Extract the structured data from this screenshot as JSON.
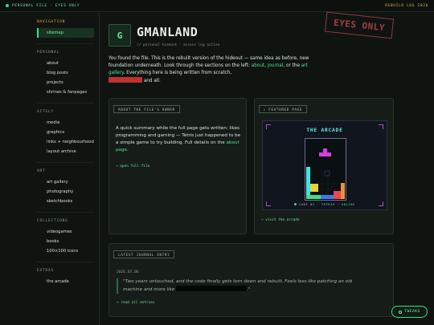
{
  "topbar": {
    "left_label": "PERSONAL FILE · EYES ONLY",
    "right_label": "REBUILD LOG 2026"
  },
  "sidebar": {
    "navigation": {
      "title": "NAVIGATION",
      "items": [
        "sitemap"
      ]
    },
    "personal": {
      "title": "PERSONAL",
      "items": [
        "about",
        "blog posts",
        "projects",
        "shrines & fanpages"
      ]
    },
    "sitely": {
      "title": "SITELY",
      "items": [
        "media",
        "graphics",
        "links + neighbourhood",
        "layout archive"
      ]
    },
    "art": {
      "title": "ART",
      "items": [
        "art gallery",
        "photography",
        "sketchbooks"
      ]
    },
    "collections": {
      "title": "COLLECTIONS",
      "items": [
        "videogames",
        "books",
        "100×100 icons"
      ]
    },
    "extras": {
      "title": "EXTRAS",
      "items": [
        "the arcade"
      ]
    }
  },
  "header": {
    "logo_letter": "G",
    "title": "GMANLAND",
    "subtitle": "// personal hideout · access log active",
    "stamp": "EYES ONLY"
  },
  "intro": {
    "text1": "You found the file. This is the rebuilt version of the hideout — same idea as before, new foundation underneath. Look through the sections on the left:",
    "link_about": "about",
    "link_journal": "journal",
    "text_or": ", or the",
    "link_gallery": "art gallery",
    "text2": ". Everything here is being written from scratch,",
    "text3": "and all."
  },
  "owner_card": {
    "tag": "ABOUT THE FILE'S OWNER",
    "text": "A quick summary while the full page gets written: likes programming and gaming — Tetris just happened to be a simple game to try building. Full details on the",
    "link": "about page",
    "open_link": "→ open full file"
  },
  "featured_card": {
    "tag": "FEATURED PAGE",
    "arcade_title": "THE ARCADE",
    "caption_left": "CART 01 · TETRIS ·",
    "caption_status": "ONLINE",
    "visit_link": "→ visit the arcade"
  },
  "journal_card": {
    "tag": "LATEST JOURNAL ENTRY",
    "date": "2026.07.06",
    "quote_start": "\"Two years untouched, and the code finally gets torn down and rebuilt. Feels less like patching an old machine and more like",
    "quote_end": ".\"",
    "read_link": "→ read all entries"
  },
  "tweaks_button": "TWEAKS",
  "colors": {
    "accent_green": "#3fdc86",
    "nav_orange": "#e6a13d",
    "stamp_red": "#a4403f",
    "redaction_red": "#c0312e"
  }
}
